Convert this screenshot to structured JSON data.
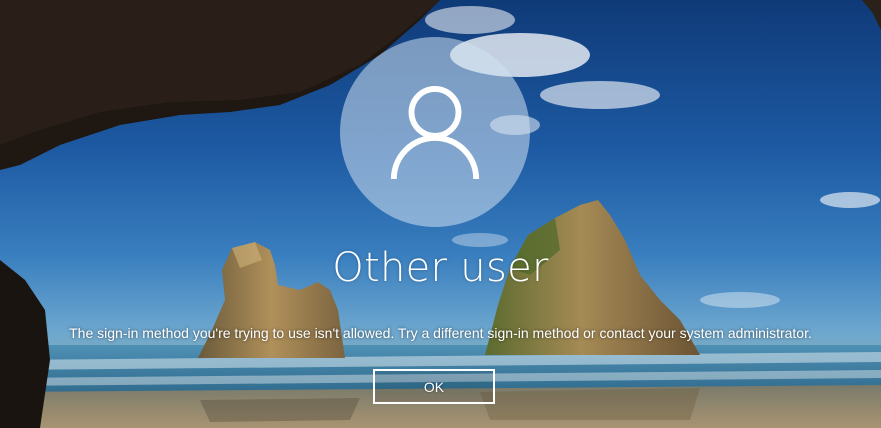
{
  "login": {
    "user_name": "Other user",
    "message": "The sign-in method you're trying to use isn't allowed. Try a different sign-in method or contact your system administrator.",
    "ok_label": "OK"
  },
  "icons": {
    "avatar": "user-silhouette-icon"
  },
  "colors": {
    "text": "#ffffff",
    "avatar_circle": "rgba(210,225,240,0.55)"
  }
}
